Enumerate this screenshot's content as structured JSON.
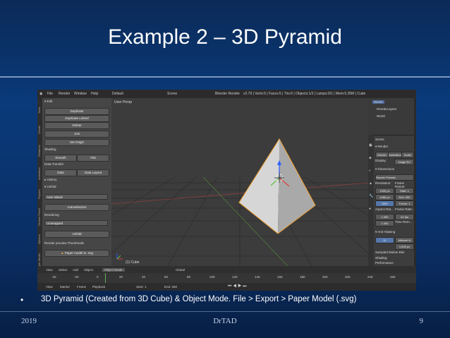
{
  "slide": {
    "title": "Example 2 – 3D Pyramid",
    "bullet": "•",
    "caption": "3D Pyramid (Created from 3D Cube) & Object Mode. File > Export > Paper Model (.svg)",
    "footer_year": "2019",
    "footer_author": "DrTAD",
    "footer_page": "9"
  },
  "blender": {
    "menu": [
      "File",
      "Render",
      "Window",
      "Help"
    ],
    "layout": "Default",
    "scene": "Scene",
    "engine": "Blender Render",
    "stats": "v2.79 | Verts:5 | Faces:5 | Tris:6 | Objects:1/3 | Lamps:0/1 | Mem:5.35M | Cube",
    "tool_tabs": [
      "Tools",
      "Create",
      "Relations",
      "Animation",
      "Physics",
      "Grease Pencil",
      "Options",
      "Paper Model"
    ],
    "toolshelf": {
      "edit_header": "Edit",
      "duplicate": "Duplicate",
      "duplicate_linked": "Duplicate Linked",
      "delete": "Delete",
      "join": "Join",
      "set_origin": "Set Origin",
      "shading": "Shading",
      "smooth": "Smooth",
      "flat": "Flat",
      "data_transfer": "Data Transfer",
      "data": "Data",
      "data_layout": "Data Layout",
      "history": "History",
      "unfold_header": "Unfold",
      "auto_island": "Auto Island",
      "autoselection": "Autoselection",
      "rendering": "Rendering",
      "render_value": "Unwrapped",
      "unfold_btn": "Unfold",
      "render_previews": "Render preview Thumbnails",
      "export_btn": "Paper model to .svg"
    },
    "viewport": {
      "label": "User Persp",
      "object_label": "(1) Cube"
    },
    "header_bar": [
      "View",
      "Select",
      "Add",
      "Object",
      "Object Mode",
      "Global"
    ],
    "timeline_numbers": [
      "-40",
      "-20",
      "0",
      "20",
      "40",
      "60",
      "80",
      "100",
      "120",
      "140",
      "160",
      "180",
      "200",
      "220",
      "240",
      "260"
    ],
    "timeline_bar": [
      "View",
      "Marker",
      "Frame",
      "Playback",
      "Start: 1",
      "End: 250"
    ],
    "outliner": [
      "Scene",
      "RenderLayers",
      "World"
    ],
    "properties": {
      "scene_label": "Scene",
      "render_header": "Render",
      "render_btn": "Render",
      "animation_btn": "Animation",
      "audio_btn": "Audio",
      "display": "Display:",
      "display_value": "Image Ed",
      "dimensions": "Dimensions",
      "render_presets": "Render Presets",
      "resolution": "Resolution:",
      "res_x": "1920 px",
      "res_y": "1080 px",
      "res_pct": "50%",
      "frame_range": "Frame Range:",
      "start": "Start: 1",
      "end": "End: 250",
      "frame": "Frame: 1",
      "aspect": "Aspect Rat...",
      "aspect_x": "1.000",
      "aspect_y": "1.000",
      "frame_rate": "Frame Rate:",
      "fps": "24 fps",
      "time_rem": "Time Rem...",
      "anti_aliasing": "Anti-Aliasing",
      "aa_value": "11",
      "aa_filter": "Mitchell-N",
      "aa_size": "1.000 px",
      "sampled_motion": "Sampled Motion Blur",
      "shading": "Shading",
      "performance": "Performance",
      "post_processing": "Post Processing"
    },
    "colors": {
      "pyramid": "#d6d6d6",
      "pyramid_shadow": "#a9a9a9",
      "select_outline": "#f0a030",
      "axis_x": "#d84040",
      "axis_y": "#60c040",
      "axis_z": "#3060ff"
    }
  }
}
